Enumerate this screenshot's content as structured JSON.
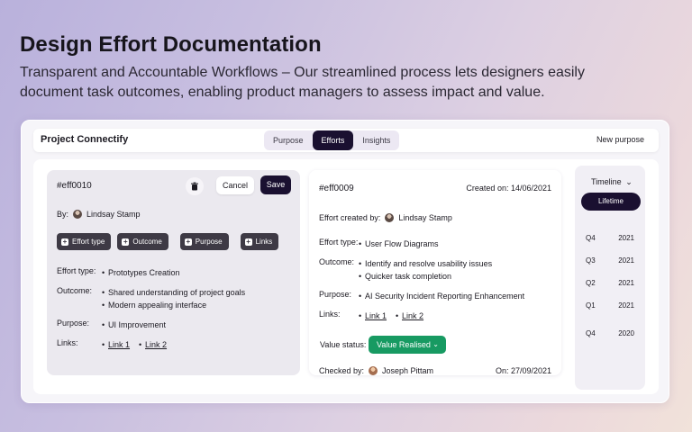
{
  "hero": {
    "title": "Design Effort Documentation",
    "subtitle": "Transparent and Accountable Workflows – Our streamlined process lets designers easily document task outcomes, enabling product managers to assess impact and value."
  },
  "topbar": {
    "project": "Project Connectify",
    "tabs": [
      {
        "label": "Purpose",
        "active": false
      },
      {
        "label": "Efforts",
        "active": true
      },
      {
        "label": "Insights",
        "active": false
      }
    ],
    "new_purpose": "New purpose"
  },
  "edit_card": {
    "id": "#eff0010",
    "cancel": "Cancel",
    "save": "Save",
    "by_label": "By:",
    "by_name": "Lindsay Stamp",
    "chips": [
      "Effort type",
      "Outcome",
      "Purpose",
      "Links"
    ],
    "effort_type_label": "Effort type:",
    "effort_type": "Prototypes Creation",
    "outcome_label": "Outcome:",
    "outcomes": [
      "Shared understanding of project goals",
      "Modern appealing interface"
    ],
    "purpose_label": "Purpose:",
    "purpose": "UI Improvement",
    "links_label": "Links:",
    "links": [
      "Link 1",
      "Link 2"
    ]
  },
  "detail_card": {
    "id": "#eff0009",
    "created_on": "Created on: 14/06/2021",
    "created_by_label": "Effort created by:",
    "created_by": "Lindsay Stamp",
    "effort_type_label": "Effort type:",
    "effort_type": "User Flow Diagrams",
    "outcome_label": "Outcome:",
    "outcomes": [
      "Identify and resolve usability issues",
      "Quicker task completion"
    ],
    "purpose_label": "Purpose:",
    "purpose": "AI Security Incident Reporting Enhancement",
    "links_label": "Links:",
    "links": [
      "Link 1",
      "Link 2"
    ],
    "value_status_label": "Value status:",
    "value_status": "Value Realised",
    "checked_by_label": "Checked by:",
    "checked_by": "Joseph Pittam",
    "checked_on": "On:  27/09/2021"
  },
  "timeline": {
    "header": "Timeline",
    "pill": "Lifetime",
    "rows": [
      {
        "q": "Q4",
        "y": "2021"
      },
      {
        "q": "Q3",
        "y": "2021"
      },
      {
        "q": "Q2",
        "y": "2021"
      },
      {
        "q": "Q1",
        "y": "2021"
      },
      {
        "q": "Q4",
        "y": "2020"
      }
    ]
  }
}
